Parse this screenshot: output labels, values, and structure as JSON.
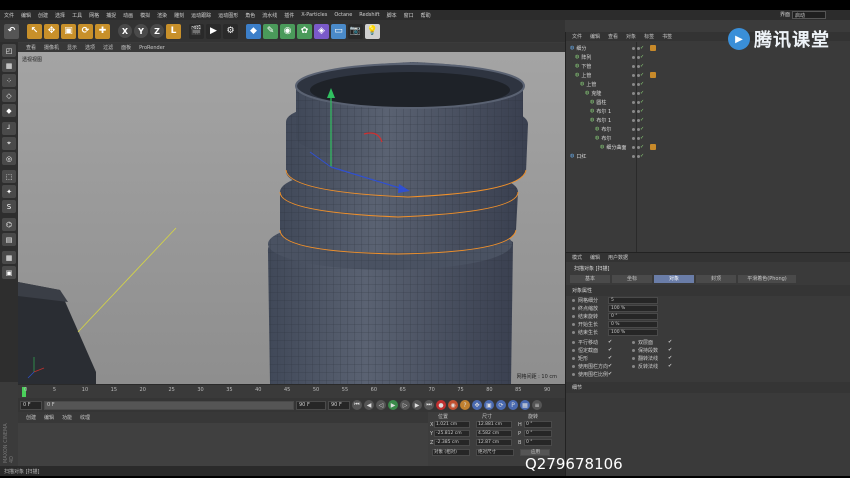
{
  "menubar": {
    "items": [
      "文件",
      "编辑",
      "创建",
      "选择",
      "工具",
      "网格",
      "捕捉",
      "动画",
      "模拟",
      "渲染",
      "雕刻",
      "运动跟踪",
      "运动图形",
      "角色",
      "流水线",
      "插件",
      "X-Particles",
      "Octane",
      "Redshift",
      "脚本",
      "窗口",
      "帮助"
    ],
    "right_label": "界面",
    "layout_value": "启动"
  },
  "toolbar": {
    "axes": [
      "X",
      "Y",
      "Z"
    ]
  },
  "viewport": {
    "menu": [
      "查看",
      "摄像机",
      "显示",
      "选项",
      "过滤",
      "面板",
      "ProRender"
    ],
    "camera_label": "透视视图",
    "grid_spacing": "网格间距 : 10 cm"
  },
  "timeline": {
    "ticks": [
      "0",
      "5",
      "10",
      "15",
      "20",
      "25",
      "30",
      "35",
      "40",
      "45",
      "50",
      "55",
      "60",
      "65",
      "70",
      "75",
      "80",
      "85",
      "90"
    ],
    "frame_right": "0 F"
  },
  "playbar": {
    "start": "0 F",
    "current": "0 F",
    "end": "90 F",
    "end2": "90 F"
  },
  "material_panel": {
    "menu": [
      "创建",
      "编辑",
      "功能",
      "纹理"
    ]
  },
  "coords": {
    "headers": [
      "位置",
      "尺寸",
      "旋转"
    ],
    "rows": [
      {
        "axis": "X",
        "pos": "1.021 cm",
        "size": "12.881 cm",
        "rot_axis": "H",
        "rot": "0 °"
      },
      {
        "axis": "Y",
        "pos": "-25.812 cm",
        "size": "4.582 cm",
        "rot_axis": "P",
        "rot": "0 °"
      },
      {
        "axis": "Z",
        "pos": "-2.385 cm",
        "size": "12.87 cm",
        "rot_axis": "B",
        "rot": "0 °"
      }
    ],
    "mode1": "对象 (相对)",
    "mode2": "绝对尺寸",
    "apply": "应用"
  },
  "object_manager": {
    "menu": [
      "文件",
      "编辑",
      "查看",
      "对象",
      "标签",
      "书签"
    ],
    "rows": [
      {
        "name": "细分",
        "indent": 0
      },
      {
        "name": "阵列",
        "indent": 1
      },
      {
        "name": "下管",
        "indent": 1
      },
      {
        "name": "上管",
        "indent": 1
      },
      {
        "name": "上管",
        "indent": 2
      },
      {
        "name": "克隆",
        "indent": 3
      },
      {
        "name": "圆柱",
        "indent": 4
      },
      {
        "name": "布尔 1",
        "indent": 4
      },
      {
        "name": "布尔 1",
        "indent": 4
      },
      {
        "name": "布尔",
        "indent": 5
      },
      {
        "name": "布尔",
        "indent": 5
      },
      {
        "name": "细分曲面",
        "indent": 6
      },
      {
        "name": "口红",
        "indent": 0
      }
    ]
  },
  "attribute_manager": {
    "menu": [
      "模式",
      "编辑",
      "用户数据"
    ],
    "title": "扫描对象 [扫描]",
    "tabs": [
      "基本",
      "坐标",
      "对象",
      "封顶",
      "平滑着色(Phong)"
    ],
    "active_tab": "对象",
    "section": "对象属性",
    "rows": [
      {
        "label": "网格细分",
        "value": "5"
      },
      {
        "label": "终点缩放",
        "value": "100 %"
      },
      {
        "label": "结束旋转",
        "value": "0 °"
      },
      {
        "label": "开始生长",
        "value": "0 %"
      },
      {
        "label": "结束生长",
        "value": "100 %"
      }
    ],
    "checks_left": [
      "平行移动",
      "恒定截面",
      "矩形",
      "使用围栏方向",
      "使用围栏比例"
    ],
    "checks_right": [
      "双层面",
      "保持段数",
      "翻转法线",
      "反转法线"
    ],
    "detail": "细节"
  },
  "status": "扫描对象 [扫描]",
  "watermark": {
    "brand": "腾讯课堂",
    "qq": "Q279678106"
  },
  "maxon": "MAXON CINEMA 4D"
}
